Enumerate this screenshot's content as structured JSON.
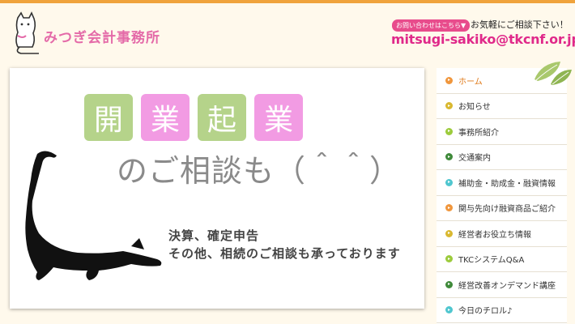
{
  "header": {
    "logo_text": "みつぎ会計事務所",
    "contact_badge": "お問い合わせはこちら▼",
    "contact_note": "お気軽にご相談下さい！",
    "email": "mitsugi-sakiko@tkcnf.or.jp"
  },
  "hero": {
    "tiles": [
      "開",
      "業",
      "起",
      "業"
    ],
    "headline": "のご相談も（＾＾）",
    "line1": "決算、確定申告",
    "line2": "その他、相続のご相談も承っております"
  },
  "sidebar": {
    "items": [
      {
        "label": "ホーム",
        "color": "#f0963c"
      },
      {
        "label": "お知らせ",
        "color": "#d9b830"
      },
      {
        "label": "事務所紹介",
        "color": "#9ccb3c"
      },
      {
        "label": "交通案内",
        "color": "#3f8a3a"
      },
      {
        "label": "補助金・助成金・融資情報",
        "color": "#4fc6cf"
      },
      {
        "label": "関与先向け融資商品ご紹介",
        "color": "#f0963c"
      },
      {
        "label": "経営者お役立ち情報",
        "color": "#d9b830"
      },
      {
        "label": "TKCシステムQ&A",
        "color": "#9ccb3c"
      },
      {
        "label": "経営改善オンデマンド講座",
        "color": "#3f8a3a"
      },
      {
        "label": "今日のチロル♪",
        "color": "#4fc6cf"
      }
    ]
  },
  "colors": {
    "accent_orange": "#f0a33c",
    "brand_pink": "#e0298a",
    "tile_green": "#b5d38a",
    "tile_pink": "#f29be3"
  }
}
